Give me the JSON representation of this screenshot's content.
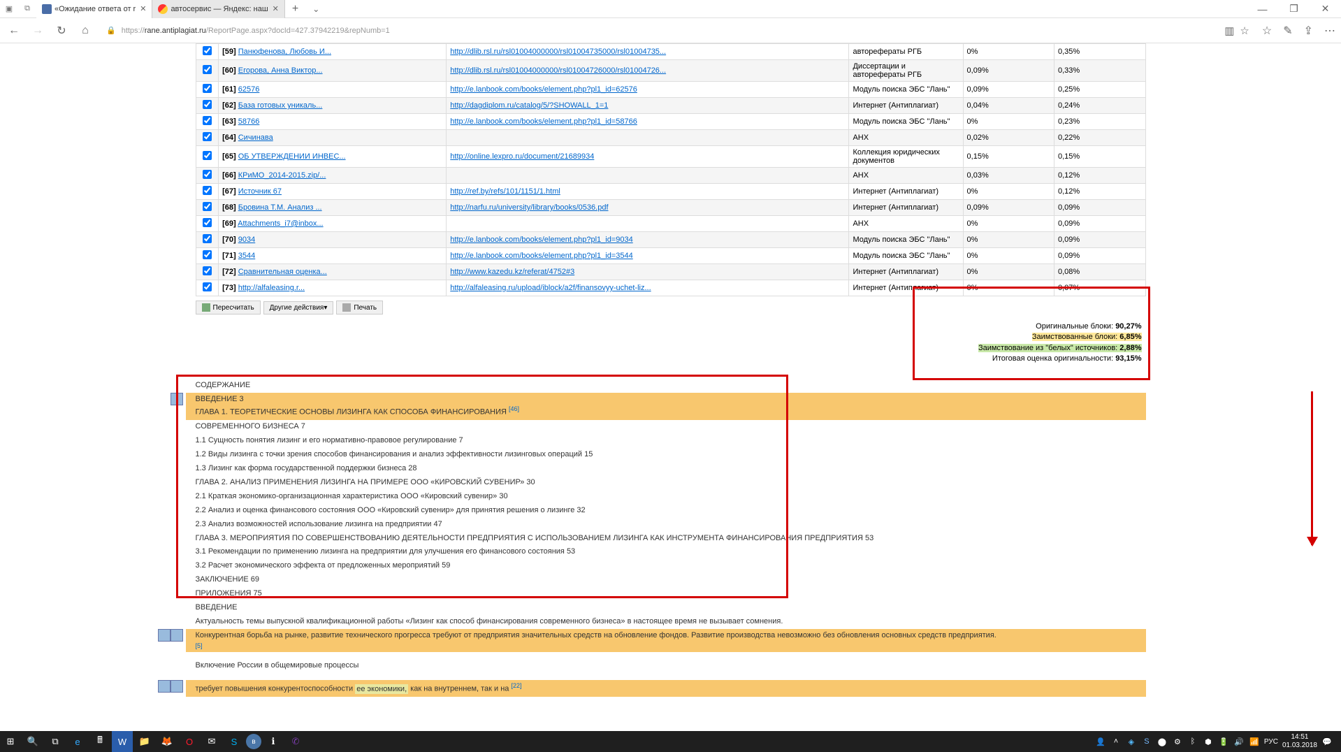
{
  "titlebar": {
    "tabs": [
      {
        "icon": "blue",
        "text": "«Ожидание ответа от r",
        "active": true
      },
      {
        "icon": "red",
        "text": "автосервис — Яндекс: наш",
        "active": false
      }
    ]
  },
  "addressbar": {
    "protocol": "https://",
    "host": "rane.antiplagiat.ru",
    "path": "/ReportPage.aspx?docId=427.37942219&repNumb=1"
  },
  "sources": [
    {
      "n": "[59]",
      "name": "Панюфенова, Любовь И...",
      "url": "http://dlib.rsl.ru/rsl01004000000/rsl01004735000/rsl01004735...",
      "src": "авторефераты РГБ",
      "p1": "0%",
      "p2": "0,35%"
    },
    {
      "n": "[60]",
      "name": "Егорова, Анна Виктор...",
      "url": "http://dlib.rsl.ru/rsl01004000000/rsl01004726000/rsl01004726...",
      "src": "Диссертации и авторефераты РГБ",
      "p1": "0,09%",
      "p2": "0,33%"
    },
    {
      "n": "[61]",
      "name": "62576",
      "url": "http://e.lanbook.com/books/element.php?pl1_id=62576",
      "src": "Модуль поиска ЭБС \"Лань\"",
      "p1": "0,09%",
      "p2": "0,25%"
    },
    {
      "n": "[62]",
      "name": "База готовых уникаль...",
      "url": "http://dagdiplom.ru/catalog/5/?SHOWALL_1=1",
      "src": "Интернет (Антиплагиат)",
      "p1": "0,04%",
      "p2": "0,24%"
    },
    {
      "n": "[63]",
      "name": "58766",
      "url": "http://e.lanbook.com/books/element.php?pl1_id=58766",
      "src": "Модуль поиска ЭБС \"Лань\"",
      "p1": "0%",
      "p2": "0,23%"
    },
    {
      "n": "[64]",
      "name": "Сичинава",
      "url": "",
      "src": "АНХ",
      "p1": "0,02%",
      "p2": "0,22%"
    },
    {
      "n": "[65]",
      "name": "ОБ УТВЕРЖДЕНИИ ИНВЕС...",
      "url": "http://online.lexpro.ru/document/21689934",
      "src": "Коллекция юридических документов",
      "p1": "0,15%",
      "p2": "0,15%"
    },
    {
      "n": "[66]",
      "name": "КРиМО_2014-2015.zip/...",
      "url": "",
      "src": "АНХ",
      "p1": "0,03%",
      "p2": "0,12%"
    },
    {
      "n": "[67]",
      "name": "Источник 67",
      "url": "http://ref.by/refs/101/1151/1.html",
      "src": "Интернет (Антиплагиат)",
      "p1": "0%",
      "p2": "0,12%"
    },
    {
      "n": "[68]",
      "name": "Бровина Т.М. Анализ ...",
      "url": "http://narfu.ru/university/library/books/0536.pdf",
      "src": "Интернет (Антиплагиат)",
      "p1": "0,09%",
      "p2": "0,09%"
    },
    {
      "n": "[69]",
      "name": "Attachments_i7@inbox...",
      "url": "",
      "src": "АНХ",
      "p1": "0%",
      "p2": "0,09%"
    },
    {
      "n": "[70]",
      "name": "9034",
      "url": "http://e.lanbook.com/books/element.php?pl1_id=9034",
      "src": "Модуль поиска ЭБС \"Лань\"",
      "p1": "0%",
      "p2": "0,09%"
    },
    {
      "n": "[71]",
      "name": "3544",
      "url": "http://e.lanbook.com/books/element.php?pl1_id=3544",
      "src": "Модуль поиска ЭБС \"Лань\"",
      "p1": "0%",
      "p2": "0,09%"
    },
    {
      "n": "[72]",
      "name": "Сравнительная оценка...",
      "url": "http://www.kazedu.kz/referat/4752#3",
      "src": "Интернет (Антиплагиат)",
      "p1": "0%",
      "p2": "0,08%"
    },
    {
      "n": "[73]",
      "name": "http://alfaleasing.r...",
      "url": "http://alfaleasing.ru/upload/iblock/a2f/finansovyy-uchet-liz...",
      "src": "Интернет (Антиплагиат)",
      "p1": "0%",
      "p2": "0,07%"
    }
  ],
  "actions": {
    "recalc": "Пересчитать",
    "other": "Другие действия▾",
    "print": "Печать"
  },
  "stats": {
    "orig_label": "Оригинальные блоки:",
    "orig_val": "90,27%",
    "borrow_label": "Заимствованные блоки:",
    "borrow_val": "6,85%",
    "white_label": "Заимствование из \"белых\" источников:",
    "white_val": "2,88%",
    "final_label": "Итоговая оценка оригинальности:",
    "final_val": "93,15%"
  },
  "doc": {
    "l1": "СОДЕРЖАНИЕ",
    "l2": "ВВЕДЕНИЕ 3",
    "l3": "ГЛАВА 1. ТЕОРЕТИЧЕСКИЕ ОСНОВЫ ЛИЗИНГА КАК СПОСОБА ФИНАНСИРОВАНИЯ ",
    "l3ref": "[46]",
    "l4": "СОВРЕМЕННОГО БИЗНЕСА 7",
    "l5": "1.1 Сущность понятия лизинг и его нормативно-правовое регулирование 7",
    "l6": "1.2 Виды лизинга с точки зрения способов финансирования и анализ эффективности лизинговых операций 15",
    "l7": "1.3 Лизинг как форма государственной поддержки бизнеса 28",
    "l8": "ГЛАВА 2. АНАЛИЗ ПРИМЕНЕНИЯ ЛИЗИНГА НА ПРИМЕРЕ ООО «КИРОВСКИЙ СУВЕНИР» 30",
    "l9": "2.1 Краткая экономико-организационная характеристика ООО «Кировский сувенир» 30",
    "l10": "2.2 Анализ и оценка финансового состояния ООО «Кировский сувенир» для принятия решения о лизинге 32",
    "l11": "2.3 Анализ возможностей использование лизинга на предприятии 47",
    "l12": "ГЛАВА 3. МЕРОПРИЯТИЯ ПО СОВЕРШЕНСТВОВАНИЮ ДЕЯТЕЛЬНОСТИ ПРЕДПРИЯТИЯ С ИСПОЛЬЗОВАНИЕМ ЛИЗИНГА КАК ИНСТРУМЕНТА ФИНАНСИРОВАНИЯ ПРЕДПРИЯТИЯ 53",
    "l13": "3.1 Рекомендации по применению лизинга на предприятии для улучшения его финансового состояния 53",
    "l14": "3.2 Расчет экономического эффекта от предложенных мероприятий 59",
    "l15": "ЗАКЛЮЧЕНИЕ 69",
    "l16": "ПРИЛОЖЕНИЯ 75",
    "l17": "ВВЕДЕНИЕ",
    "l18": "Актуальность темы выпускной квалификационной работы «Лизинг как способ финансирования современного бизнеса» в настоящее время не вызывает сомнения.",
    "l19": "Конкурентная борьба на рынке, развитие технического прогресса требуют от предприятия значительных средств на обновление фондов. Развитие производства невозможно без обновления основных средств предприятия.",
    "l19ref": "[5]",
    "l20": "Включение России в общемировые процессы",
    "l21a": "требует повышения конкурентоспособности ",
    "l21b": "ее экономики,",
    "l21c": " как на внутреннем, так и на ",
    "l21ref": "[22]"
  },
  "taskbar": {
    "lang": "РУС",
    "time": "14:51",
    "date": "01.03.2018"
  }
}
